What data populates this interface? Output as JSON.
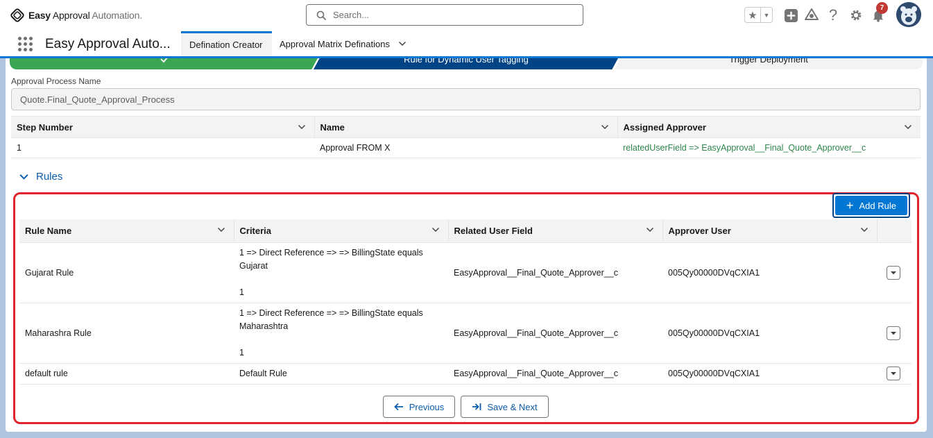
{
  "header": {
    "logo_bold": "Easy",
    "logo_mid": " Approval",
    "logo_light": " Automation.",
    "search_placeholder": "Search...",
    "notification_count": "7",
    "icons": [
      "search-icon",
      "favorite-star-icon",
      "chevron-down-icon",
      "global-add-icon",
      "trailhead-icon",
      "help-icon",
      "settings-gear-icon",
      "notification-bell-icon",
      "avatar"
    ]
  },
  "nav": {
    "app_name": "Easy Approval Auto...",
    "tabs": [
      {
        "label": "Defination Creator",
        "active": true
      },
      {
        "label": "Approval Matrix Definations",
        "active": false
      }
    ]
  },
  "path": {
    "steps": [
      {
        "label": "",
        "status": "complete"
      },
      {
        "label": "Rule for Dynamic User Tagging",
        "status": "current"
      },
      {
        "label": "Trigger Deployment",
        "status": "incomplete"
      }
    ]
  },
  "process": {
    "label": "Approval Process Name",
    "value": "Quote.Final_Quote_Approval_Process"
  },
  "steps_table": {
    "headers": [
      "Step Number",
      "Name",
      "Assigned Approver"
    ],
    "rows": [
      {
        "step": "1",
        "name": "Approval FROM X",
        "approver": "relatedUserField => EasyApproval__Final_Quote_Approver__c"
      }
    ]
  },
  "rules_section": {
    "title": "Rules",
    "add_button": "Add Rule",
    "headers": [
      "Rule Name",
      "Criteria",
      "Related User Field",
      "Approver User"
    ],
    "rows": [
      {
        "name": "Gujarat Rule",
        "criteria_line1": "1 => Direct Reference => => BillingState equals",
        "criteria_line2": "Gujarat",
        "criteria_line3": "1",
        "field": "EasyApproval__Final_Quote_Approver__c",
        "approver": "005Qy00000DVqCXIA1"
      },
      {
        "name": "Maharashra Rule",
        "criteria_line1": "1 => Direct Reference => => BillingState equals",
        "criteria_line2": "Maharashtra",
        "criteria_line3": "1",
        "field": "EasyApproval__Final_Quote_Approver__c",
        "approver": "005Qy00000DVqCXIA1"
      },
      {
        "name": "default rule",
        "criteria_line1": "Default Rule",
        "field": "EasyApproval__Final_Quote_Approver__c",
        "approver": "005Qy00000DVqCXIA1"
      }
    ],
    "highlight_color": "#e0232e"
  },
  "footer": {
    "previous": "Previous",
    "save_next": "Save & Next"
  },
  "colors": {
    "brand": "#0176d3",
    "path_complete": "#3ba755",
    "path_current": "#014486",
    "link": "#0b5cab",
    "approver_green": "#2e844a"
  }
}
